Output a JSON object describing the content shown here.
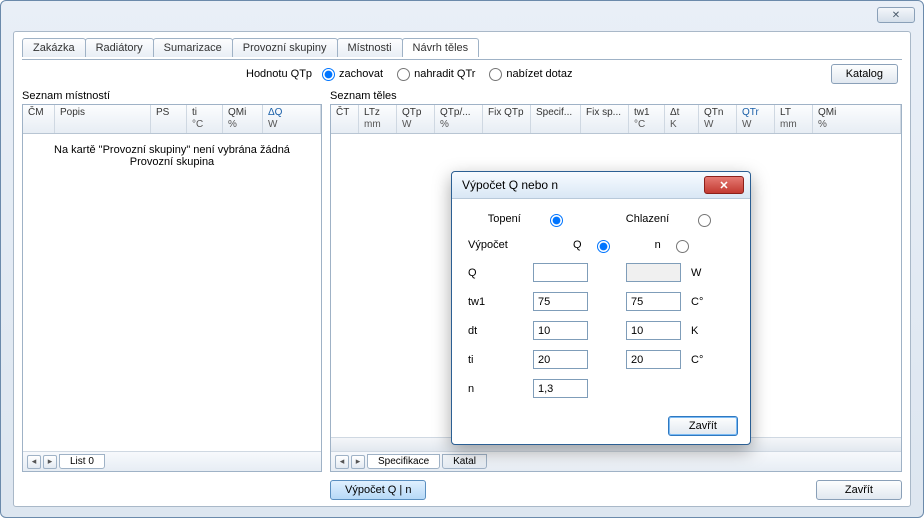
{
  "window": {
    "close_glyph": "✕"
  },
  "tabs": {
    "items": [
      "Zakázka",
      "Radiátory",
      "Sumarizace",
      "Provozní skupiny",
      "Místnosti",
      "Návrh těles"
    ],
    "active_index": 5
  },
  "qtp_row": {
    "label": "Hodnotu QTp",
    "options": [
      "zachovat",
      "nahradit QTr",
      "nabízet dotaz"
    ],
    "selected_index": 0,
    "katalog_btn": "Katalog"
  },
  "left_pane": {
    "title": "Seznam místností",
    "cols": [
      {
        "h": "ČM",
        "sub": ""
      },
      {
        "h": "Popis",
        "sub": ""
      },
      {
        "h": "PS",
        "sub": ""
      },
      {
        "h": "ti",
        "sub": "°C"
      },
      {
        "h": "QMi",
        "sub": "%"
      },
      {
        "h": "ΔQ",
        "sub": "W"
      }
    ],
    "sorted_col": 5,
    "empty_line1": "Na kartě \"Provozní skupiny\" není vybrána žádná",
    "empty_line2": "Provozní skupina",
    "bottom_tab": "List 0"
  },
  "right_pane": {
    "title": "Seznam těles",
    "cols": [
      {
        "h": "ČT",
        "sub": ""
      },
      {
        "h": "LTz",
        "sub": "mm"
      },
      {
        "h": "QTp",
        "sub": "W"
      },
      {
        "h": "QTp/...",
        "sub": "%"
      },
      {
        "h": "Fix QTp",
        "sub": ""
      },
      {
        "h": "Specif...",
        "sub": ""
      },
      {
        "h": "Fix sp...",
        "sub": ""
      },
      {
        "h": "tw1",
        "sub": "°C"
      },
      {
        "h": "Δt",
        "sub": "K"
      },
      {
        "h": "QTn",
        "sub": "W"
      },
      {
        "h": "QTr",
        "sub": "W"
      },
      {
        "h": "LT",
        "sub": "mm"
      },
      {
        "h": "QMi",
        "sub": "%"
      }
    ],
    "sorted_col": 10,
    "bottom_tabs": [
      "Specifikace",
      "Katal"
    ]
  },
  "footer": {
    "calc_btn": "Výpočet Q | n",
    "close_btn": "Zavřít"
  },
  "dialog": {
    "title": "Výpočet Q nebo n",
    "mode": {
      "opt1": "Topení",
      "opt2": "Chlazení",
      "sel": 0
    },
    "calc": {
      "label": "Výpočet",
      "opt1": "Q",
      "opt2": "n",
      "sel": 0
    },
    "rows": {
      "Q": {
        "label": "Q",
        "v1": "",
        "v2": "",
        "unit": "W",
        "ro2": true
      },
      "tw1": {
        "label": "tw1",
        "v1": "75",
        "v2": "75",
        "unit": "C°"
      },
      "dt": {
        "label": "dt",
        "v1": "10",
        "v2": "10",
        "unit": "K"
      },
      "ti": {
        "label": "ti",
        "v1": "20",
        "v2": "20",
        "unit": "C°"
      },
      "n": {
        "label": "n",
        "v1": "1,3",
        "v2": null,
        "unit": ""
      }
    },
    "close_btn": "Zavřít"
  }
}
